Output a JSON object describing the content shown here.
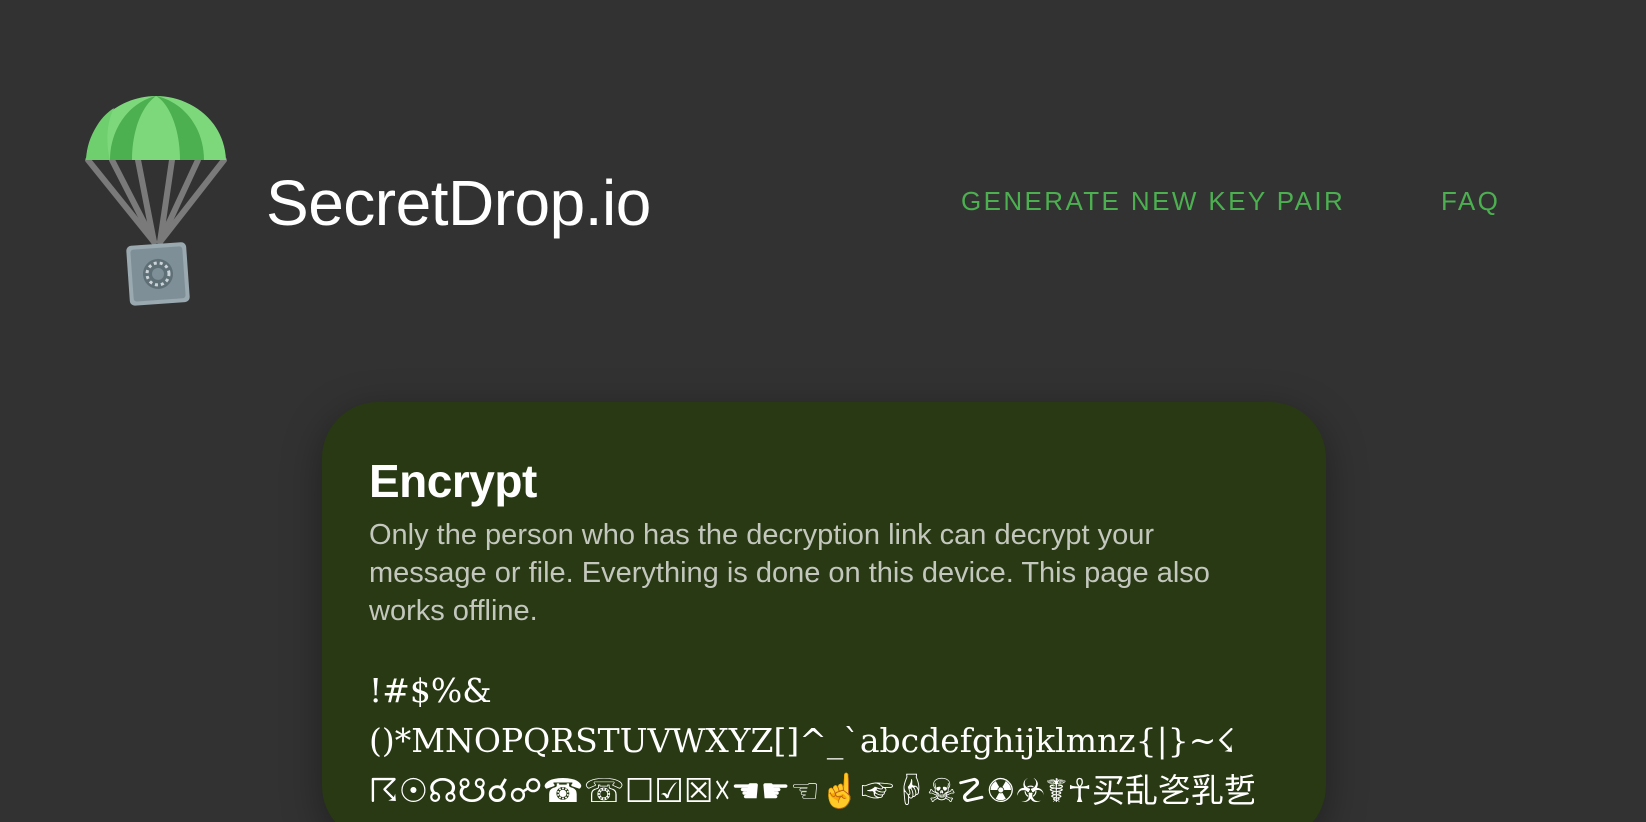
{
  "header": {
    "brand": "SecretDrop.io",
    "logo_icon": "parachute-safe-icon",
    "nav": [
      {
        "label": "GENERATE NEW KEY PAIR"
      },
      {
        "label": "FAQ"
      }
    ]
  },
  "colors": {
    "background": "#323232",
    "accent": "#4caf50",
    "card": "#283914",
    "parachute_light": "#7dd87c",
    "parachute_dark": "#4caf50"
  },
  "card": {
    "title": "Encrypt",
    "description": "Only the person who has the decryption link can decrypt your message or file. Everything is done on this device. This page also works offline.",
    "charset_lines": [
      "!#$%&",
      "()*MNOPQRSTUVWXYZ[]^_`abcdefghijklmnz{|}~☇",
      "☈☉☊☋☌☍☎☏☐☑☒☓☚☛☜☝☞☟☠☡☢☣☤☥买乱乲乳乴"
    ]
  }
}
